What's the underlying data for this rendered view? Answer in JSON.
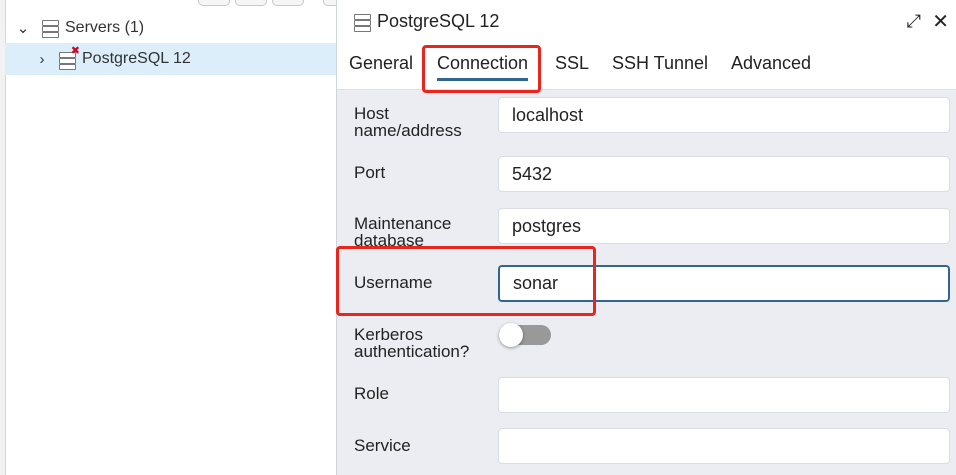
{
  "tree": {
    "servers_label": "Servers (1)",
    "server_label": "PostgreSQL 12"
  },
  "dialog": {
    "title": "PostgreSQL 12",
    "tabs": [
      {
        "label": "General"
      },
      {
        "label": "Connection",
        "active": true
      },
      {
        "label": "SSL"
      },
      {
        "label": "SSH Tunnel"
      },
      {
        "label": "Advanced"
      }
    ],
    "fields": {
      "host": {
        "label": "Host name/address",
        "value": "localhost"
      },
      "port": {
        "label": "Port",
        "value": "5432"
      },
      "maintenance_db": {
        "label": "Maintenance database",
        "value": "postgres"
      },
      "username": {
        "label": "Username",
        "value": "sonar"
      },
      "kerberos": {
        "label": "Kerberos authentication?",
        "enabled": false
      },
      "role": {
        "label": "Role",
        "value": ""
      },
      "service": {
        "label": "Service",
        "value": ""
      }
    }
  },
  "icons": {
    "server_group": "database-stack-icon",
    "server": "database-server-icon",
    "disconnected": "red-x-icon",
    "expand": "expand-arrows-icon",
    "close": "close-icon"
  },
  "colors": {
    "accent": "#326690",
    "selection": "#dbeefa",
    "highlight": "#e8261d"
  }
}
